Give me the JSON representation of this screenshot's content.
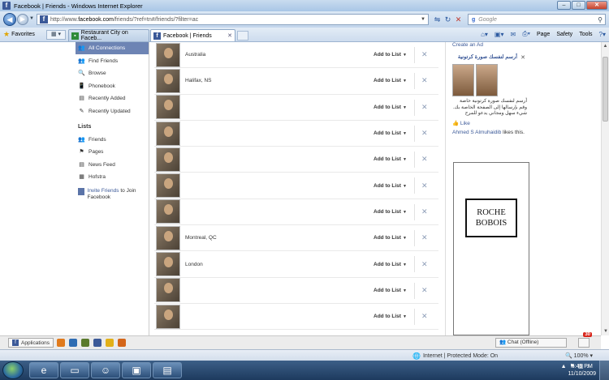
{
  "window": {
    "title": "Facebook | Friends - Windows Internet Explorer",
    "minimize": "‒",
    "maximize": "□",
    "close": "✕"
  },
  "addressbar": {
    "url_prefix": "http://www.",
    "url_domain": "facebook.com",
    "url_rest": "/friends/?ref=tn#/friends/?filter=ac",
    "search_engine_letter": "g",
    "search_placeholder": "Google"
  },
  "tabs": {
    "favorites_label": "Favorites",
    "items": [
      {
        "label": "Restaurant City on Faceb..."
      },
      {
        "label": "Facebook | Friends"
      }
    ]
  },
  "commandbar": {
    "page": "Page",
    "safety": "Safety",
    "tools": "Tools"
  },
  "leftnav": {
    "items": [
      {
        "label": "All Connections"
      },
      {
        "label": "Find Friends"
      },
      {
        "label": "Browse"
      },
      {
        "label": "Phonebook"
      },
      {
        "label": "Recently Added"
      },
      {
        "label": "Recently Updated"
      }
    ],
    "lists_heading": "Lists",
    "lists": [
      {
        "label": "Friends"
      },
      {
        "label": "Pages"
      },
      {
        "label": "News Feed"
      },
      {
        "label": "Hofstra"
      }
    ],
    "invite_link": "Invite Friends",
    "invite_rest": " to Join Facebook"
  },
  "friends": {
    "add_to_list_label": "Add to List",
    "rows": [
      {
        "location": "Australia"
      },
      {
        "location": "Halifax, NS"
      },
      {
        "location": ""
      },
      {
        "location": ""
      },
      {
        "location": ""
      },
      {
        "location": ""
      },
      {
        "location": ""
      },
      {
        "location": "Montreal, QC"
      },
      {
        "location": "London"
      },
      {
        "location": ""
      },
      {
        "location": ""
      }
    ]
  },
  "rightcol": {
    "create_ad": "Create an Ad",
    "ad1_title": "أرسم لنفسك صورة كرتونية",
    "ad1_body": "أرسم لنفسك صورة كرتونية خاصة وقم بإرسالها إلى الصفحة الخاصة بك. شيء سهل ومجاني يدعو للمرح",
    "ad1_like": "Like",
    "ad1_liker_name": "Ahmed S Almuhaidib",
    "ad1_liker_rest": " likes this.",
    "ad2_line1": "ROCHE",
    "ad2_line2": "BOBOIS"
  },
  "appbar": {
    "applications": "Applications",
    "chat": "Chat (Offline)",
    "notif_count": "30"
  },
  "iestatus": {
    "zone": "Internet | Protected Mode: On",
    "zoom": "100%"
  },
  "taskbar": {
    "time": "6:49 PM",
    "date": "11/10/2009"
  }
}
